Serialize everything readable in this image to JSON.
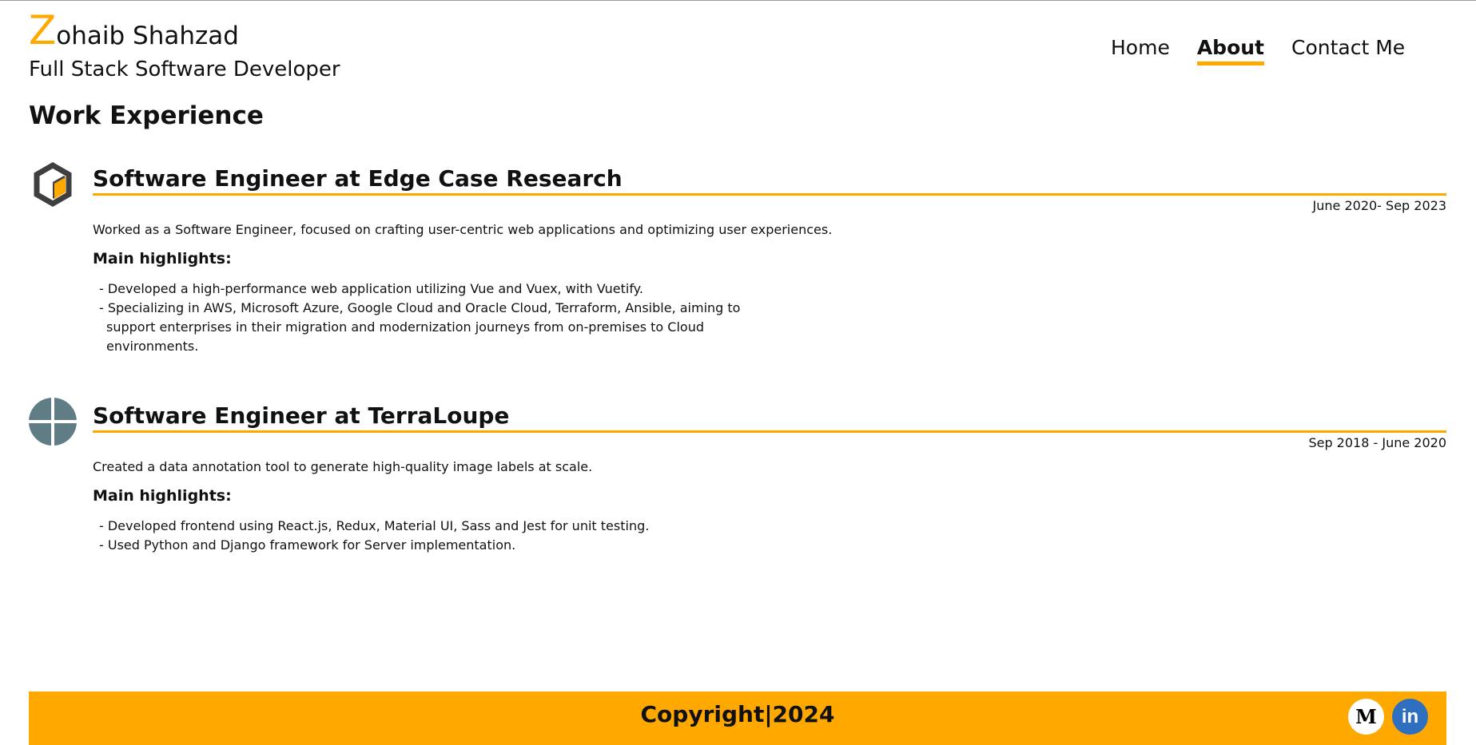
{
  "header": {
    "brand_initial": "Z",
    "brand_rest": "ohaib Shahzad",
    "subtitle": "Full Stack Software Developer"
  },
  "nav": {
    "home": "Home",
    "about": "About",
    "contact": "Contact Me",
    "active": "About"
  },
  "section": {
    "title": "Work Experience"
  },
  "jobs": [
    {
      "title": "Software Engineer at Edge Case Research",
      "dates": "June 2020- Sep 2023",
      "description": "Worked as a Software Engineer, focused on crafting user-centric web applications and optimizing user experiences.",
      "highlights_title": "Main highlights:",
      "highlights": [
        "Developed a high-performance web application utilizing Vue and Vuex, with Vuetify.",
        "Specializing in AWS, Microsoft Azure, Google Cloud and Oracle Cloud, Terraform, Ansible, aiming to support enterprises in their migration and modernization journeys from on-premises to Cloud environments."
      ],
      "logo_icon": "edge-case-research-logo-icon"
    },
    {
      "title": "Software Engineer at TerraLoupe",
      "dates": "Sep 2018 - June 2020",
      "description": "Created a data annotation tool to generate high-quality image labels at scale.",
      "highlights_title": "Main highlights:",
      "highlights": [
        "Developed frontend using React.js, Redux, Material UI, Sass and Jest for unit testing.",
        "Used Python and Django framework for Server implementation."
      ],
      "logo_icon": "terraloupe-logo-icon"
    }
  ],
  "footer": {
    "copyright": "Copyright|2024",
    "social": [
      {
        "name": "medium-icon",
        "glyph": "M"
      },
      {
        "name": "linkedin-icon",
        "glyph": "in"
      }
    ]
  },
  "colors": {
    "accent": "#ffa800",
    "text": "#111111",
    "logo_gray": "#607d86",
    "linkedin_blue": "#2f6fbf"
  }
}
